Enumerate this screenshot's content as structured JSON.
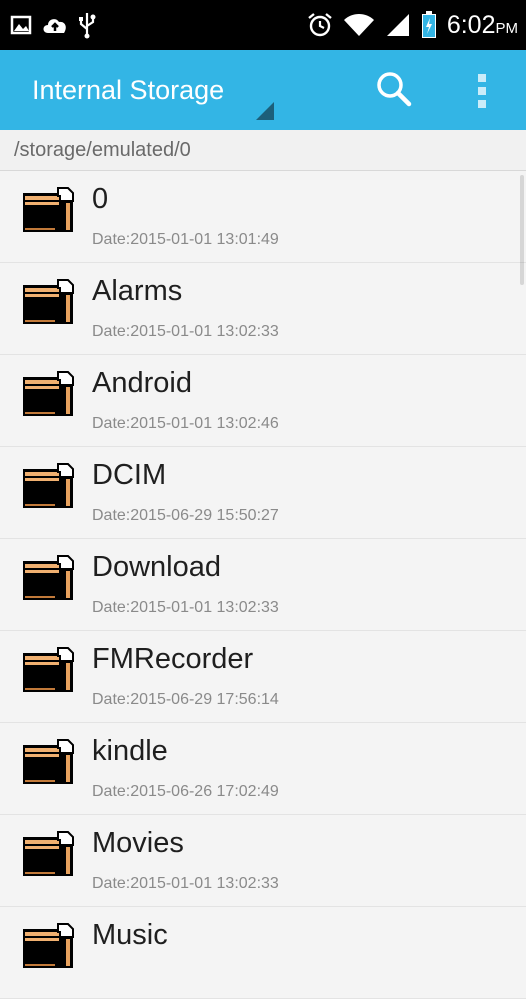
{
  "status_bar": {
    "left_icons": [
      "picture-icon",
      "cloud-upload-icon",
      "usb-icon"
    ],
    "right_icons": [
      "alarm-icon",
      "wifi-icon",
      "signal-icon",
      "battery-charging-icon"
    ],
    "time": "6:02",
    "ampm": "PM"
  },
  "action_bar": {
    "title": "Internal Storage",
    "search_icon": "search-icon",
    "overflow_icon": "overflow-menu-icon",
    "color": "#33b5e5"
  },
  "path": "/storage/emulated/0",
  "files": [
    {
      "name": "0",
      "date": "Date:2015-01-01 13:01:49"
    },
    {
      "name": "Alarms",
      "date": "Date:2015-01-01 13:02:33"
    },
    {
      "name": "Android",
      "date": "Date:2015-01-01 13:02:46"
    },
    {
      "name": "DCIM",
      "date": "Date:2015-06-29 15:50:27"
    },
    {
      "name": "Download",
      "date": "Date:2015-01-01 13:02:33"
    },
    {
      "name": "FMRecorder",
      "date": "Date:2015-06-29 17:56:14"
    },
    {
      "name": "kindle",
      "date": "Date:2015-06-26 17:02:49"
    },
    {
      "name": "Movies",
      "date": "Date:2015-01-01 13:02:33"
    },
    {
      "name": "Music",
      "date": ""
    }
  ]
}
